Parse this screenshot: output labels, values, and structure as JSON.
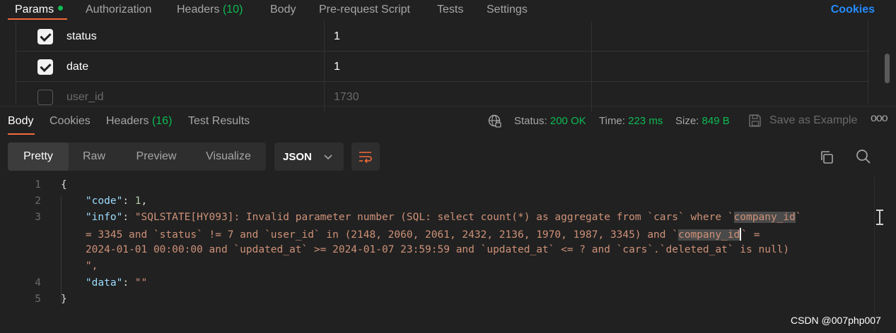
{
  "request_tabs": {
    "params": "Params",
    "authorization": "Authorization",
    "headers": "Headers",
    "headers_count": "(10)",
    "body": "Body",
    "pre_request_script": "Pre-request Script",
    "tests": "Tests",
    "settings": "Settings",
    "cookies": "Cookies"
  },
  "params": [
    {
      "enabled": true,
      "key": "status",
      "value": "1"
    },
    {
      "enabled": true,
      "key": "date",
      "value": "1"
    },
    {
      "enabled": false,
      "key": "user_id",
      "value": "1730"
    }
  ],
  "response_tabs": {
    "body": "Body",
    "cookies": "Cookies",
    "headers": "Headers",
    "headers_count": "(16)",
    "test_results": "Test Results"
  },
  "response_meta": {
    "status_label": "Status:",
    "status_value": "200 OK",
    "time_label": "Time:",
    "time_value": "223 ms",
    "size_label": "Size:",
    "size_value": "849 B",
    "save_as_example": "Save as Example",
    "more": "ooo"
  },
  "view_modes": [
    "Pretty",
    "Raw",
    "Preview",
    "Visualize"
  ],
  "format": "JSON",
  "code": {
    "line_numbers": [
      "1",
      "2",
      "3",
      "",
      "",
      "",
      "4",
      "5"
    ],
    "open_brace": "{",
    "code_key": "\"code\"",
    "code_value": "1",
    "info_key": "\"info\"",
    "info_part1": "\"SQLSTATE[HY093]: Invalid parameter number (SQL: select count(*) as aggregate from `cars` where `",
    "info_hl1": "company_id",
    "info_part2": "`",
    "info_part3": "    = 3345 and `status` != 7 and `user_id` in (2148, 2060, 2061, 2432, 2136, 1970, 1987, 3345) and `",
    "info_hl2": "company_id",
    "info_part4": "` =",
    "info_part5": "    2024-01-01 00:00:00 and `updated_at` >= 2024-01-07 23:59:59 and `updated_at` <= ? and `cars`.`deleted_at` is null)",
    "info_part6": "    \",",
    "data_key": "\"data\"",
    "data_value": "\"\"",
    "close_brace": "}"
  },
  "watermark": "CSDN @007php007",
  "colors": {
    "background": "#212121",
    "accent_orange": "#f26b3a",
    "status_green": "#0cbb52",
    "link_blue": "#268bff"
  }
}
